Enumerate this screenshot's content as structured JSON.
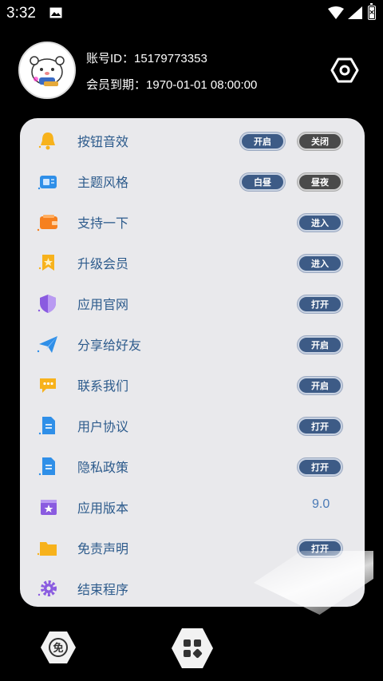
{
  "status_bar": {
    "time": "3:32"
  },
  "profile": {
    "account_label": "账号ID：",
    "account_id": "15179773353",
    "expire_label": "会员到期：",
    "expire_date": "1970-01-01 08:00:00"
  },
  "menu": {
    "items": [
      {
        "label": "按钮音效",
        "buttons": [
          "开启",
          "关闭"
        ]
      },
      {
        "label": "主题风格",
        "buttons": [
          "白昼",
          "昼夜"
        ]
      },
      {
        "label": "支持一下",
        "buttons": [
          "进入"
        ]
      },
      {
        "label": "升级会员",
        "buttons": [
          "进入"
        ]
      },
      {
        "label": "应用官网",
        "buttons": [
          "打开"
        ]
      },
      {
        "label": "分享给好友",
        "buttons": [
          "开启"
        ]
      },
      {
        "label": "联系我们",
        "buttons": [
          "开启"
        ]
      },
      {
        "label": "用户协议",
        "buttons": [
          "打开"
        ]
      },
      {
        "label": "隐私政策",
        "buttons": [
          "打开"
        ]
      },
      {
        "label": "应用版本",
        "value": "9.0"
      },
      {
        "label": "免责声明",
        "buttons": [
          "打开"
        ]
      },
      {
        "label": "结束程序"
      }
    ]
  },
  "bottom_nav": {
    "free_badge": "免"
  },
  "colors": {
    "accent": "#3d5b86",
    "dark_button": "#4a4a4a",
    "label": "#2d5b8c",
    "panel": "#e9e9ec"
  },
  "icons": [
    "bell-icon",
    "radio-icon",
    "wallet-icon",
    "badge-icon",
    "shield-icon",
    "paper-plane-icon",
    "chat-icon",
    "document-icon",
    "document-icon",
    "film-icon",
    "folder-icon",
    "gear-icon",
    "settings-hexagon-icon",
    "apps-grid-icon"
  ]
}
